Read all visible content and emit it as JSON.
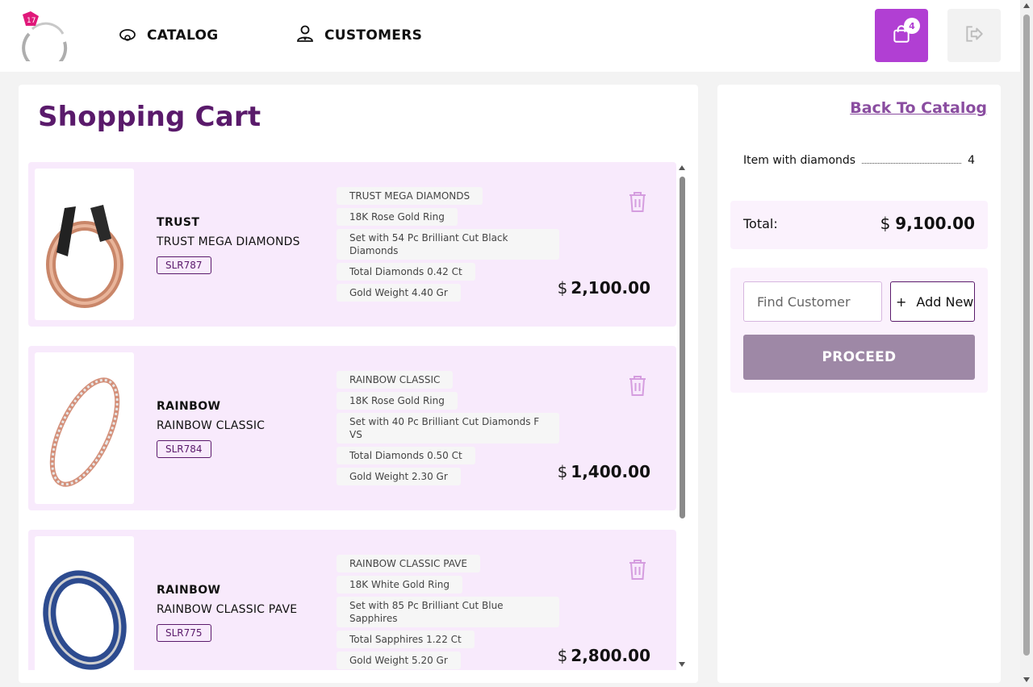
{
  "nav": {
    "catalog_label": "CATALOG",
    "customers_label": "CUSTOMERS",
    "cart_count": "4"
  },
  "cart": {
    "title": "Shopping Cart",
    "items": [
      {
        "brand": "TRUST",
        "name": "TRUST MEGA DIAMONDS",
        "sku": "SLR787",
        "tags": [
          "TRUST MEGA DIAMONDS",
          "18K Rose Gold Ring",
          "Set with 54 Pc Brilliant Cut Black Diamonds",
          "Total Diamonds 0.42 Ct",
          "Gold Weight 4.40 Gr"
        ],
        "currency": "$",
        "price": "2,100.00"
      },
      {
        "brand": "RAINBOW",
        "name": "RAINBOW CLASSIC",
        "sku": "SLR784",
        "tags": [
          "RAINBOW CLASSIC",
          "18K Rose Gold Ring",
          "Set with 40 Pc Brilliant Cut Diamonds F VS",
          "Total Diamonds 0.50 Ct",
          "Gold Weight 2.30 Gr"
        ],
        "currency": "$",
        "price": "1,400.00"
      },
      {
        "brand": "RAINBOW",
        "name": "RAINBOW CLASSIC PAVE",
        "sku": "SLR775",
        "tags": [
          "RAINBOW CLASSIC PAVE",
          "18K White Gold Ring",
          "Set with 85 Pc Brilliant Cut Blue Sapphires",
          "Total Sapphires 1.22 Ct",
          "Gold Weight 5.20 Gr"
        ],
        "currency": "$",
        "price": "2,800.00"
      }
    ]
  },
  "summary": {
    "back_label": "Back To Catalog",
    "count_label": "Item with diamonds",
    "count_value": "4",
    "total_label": "Total:",
    "currency": "$",
    "total_value": "9,100.00",
    "find_placeholder": "Find Customer",
    "add_icon": "+",
    "add_label": "Add New",
    "proceed_label": "PROCEED"
  },
  "icons": {
    "logo": "ring-logo",
    "catalog": "ring-icon",
    "customers": "user-icon",
    "cart": "shopping-bag-icon",
    "logout": "logout-icon",
    "delete": "trash-icon"
  },
  "colors": {
    "brand_purple": "#5a1a6b",
    "accent": "#b13fd3",
    "item_bg": "#f8eafc",
    "proceed_bg": "#9e88a6"
  }
}
